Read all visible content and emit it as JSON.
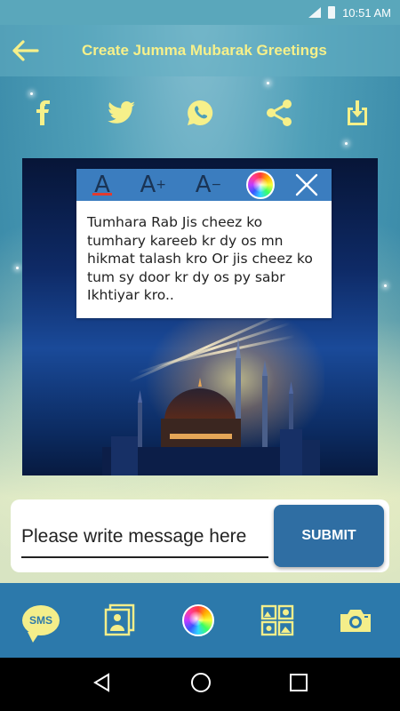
{
  "status_bar": {
    "time": "10:51 AM"
  },
  "app_bar": {
    "title": "Create Jumma Mubarak Greetings",
    "back_icon": "arrow-left-icon"
  },
  "share": {
    "items": [
      {
        "name": "facebook-icon"
      },
      {
        "name": "twitter-icon"
      },
      {
        "name": "whatsapp-icon"
      },
      {
        "name": "share-icon"
      },
      {
        "name": "download-icon"
      }
    ]
  },
  "editor": {
    "tools": {
      "font_color": "A",
      "increase": "A",
      "increase_sup": "+",
      "decrease": "A",
      "decrease_sup": "−"
    },
    "message": "Tumhara Rab Jis cheez ko tumhary kareeb kr dy os mn hikmat talash kro Or jis cheez ko tum sy door kr dy os py sabr Ikhtiyar kro.."
  },
  "input": {
    "placeholder": "Please write message here",
    "submit_label": "SUBMIT"
  },
  "bottom_bar": {
    "sms_label": "SMS",
    "items": [
      "sms-icon",
      "photo-gallery-icon",
      "color-wheel-icon",
      "image-collage-icon",
      "camera-icon"
    ]
  },
  "colors": {
    "title": "#f6f08a",
    "toolbar": "#3b7dbf",
    "submit": "#2f6ea3",
    "bottom_bar": "#2c79ab",
    "accent_yellow": "#f4ee8a"
  }
}
